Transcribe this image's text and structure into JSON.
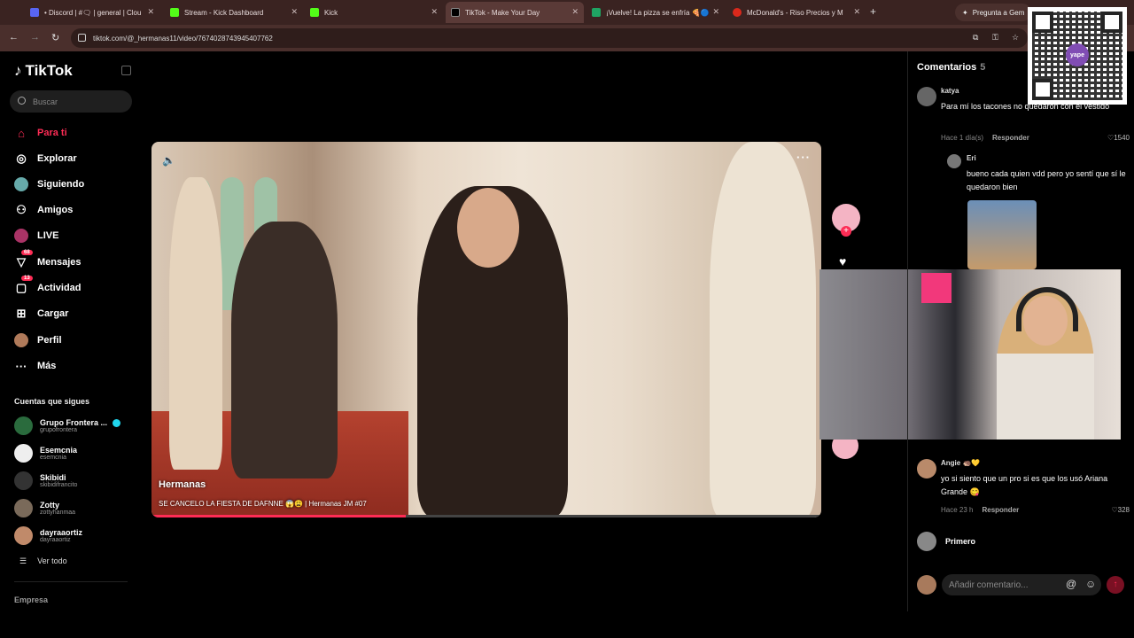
{
  "browser": {
    "tabs": [
      {
        "label": "• Discord | #🗨 | general | Clou",
        "color": "#5865f2",
        "active": false
      },
      {
        "label": "Stream - Kick Dashboard",
        "color": "#53fc18",
        "active": false
      },
      {
        "label": "Kick",
        "color": "#53fc18",
        "active": false
      },
      {
        "label": "TikTok - Make Your Day",
        "color": "#000000",
        "active": true
      },
      {
        "label": "¡Vuelve! La pizza se enfría 🍕🔵",
        "color": "#1fa463",
        "active": false
      },
      {
        "label": "McDonald's - Riso Precios y M",
        "color": "#da291c",
        "active": false
      }
    ],
    "gemini_label": "Pregunta a Gem",
    "url": "tiktok.com/@_hermanas11/video/7674028743945407762"
  },
  "qr": {
    "logo_text": "yape"
  },
  "sidebar": {
    "brand": "TikTok",
    "search_placeholder": "Buscar",
    "nav": [
      {
        "label": "Para ti",
        "icon": "home-icon",
        "glyph": "⌂",
        "active": true
      },
      {
        "label": "Explorar",
        "icon": "compass-icon",
        "glyph": "◎",
        "active": false
      },
      {
        "label": "Siguiendo",
        "icon": "following-avatar-icon",
        "glyph": "●",
        "active": false
      },
      {
        "label": "Amigos",
        "icon": "friends-icon",
        "glyph": "⚇",
        "active": false
      },
      {
        "label": "LIVE",
        "icon": "live-icon",
        "glyph": "◉",
        "active": false
      },
      {
        "label": "Mensajes",
        "icon": "messages-icon",
        "glyph": "▽",
        "active": false,
        "badge": "68"
      },
      {
        "label": "Actividad",
        "icon": "activity-icon",
        "glyph": "▢",
        "active": false,
        "badge": "13"
      },
      {
        "label": "Cargar",
        "icon": "upload-icon",
        "glyph": "⊞",
        "active": false
      },
      {
        "label": "Perfil",
        "icon": "profile-icon",
        "glyph": "●",
        "active": false
      },
      {
        "label": "Más",
        "icon": "more-icon",
        "glyph": "···",
        "active": false
      }
    ],
    "following_title": "Cuentas que sigues",
    "following": [
      {
        "name": "Grupo Frontera ...",
        "handle": "grupofrontera",
        "verified": true,
        "color": "#2a6b3d"
      },
      {
        "name": "Esemcnia",
        "handle": "esemcnia",
        "verified": false,
        "color": "#eeeeee"
      },
      {
        "name": "Skibidi",
        "handle": "skibidifrancito",
        "verified": false,
        "color": "#333333"
      },
      {
        "name": "Zotty",
        "handle": "zottyhanmaa",
        "verified": false,
        "color": "#7a6a5a"
      },
      {
        "name": "dayraaortiz",
        "handle": "dayraaortiz",
        "verified": false,
        "color": "#c08a6a"
      }
    ],
    "see_all": "Ver todo",
    "company": "Empresa"
  },
  "video": {
    "author": "Hermanas",
    "description": "SE CANCELO LA FIESTA DE DAFNNE 😱😩 | Hermanas JM #07",
    "progress": 0.38
  },
  "comments": {
    "title": "Comentarios",
    "count": "5",
    "items": [
      {
        "user": "katya",
        "text": "Para mí los tacones no quedaron con el vestido",
        "time": "Hace 1 día(s)",
        "reply": "Responder",
        "likes": "1540"
      },
      {
        "user": "Eri",
        "text": "bueno cada quien vdd pero yo sentí que sí le quedaron bien"
      },
      {
        "user": "Angie 🦔💛",
        "text": "yo si siento que un pro si es que los usó Ariana Grande 😋",
        "time": "Hace 23 h",
        "reply": "Responder",
        "likes": "328"
      }
    ],
    "first_label": "Primero",
    "add_placeholder": "Añadir comentario..."
  }
}
